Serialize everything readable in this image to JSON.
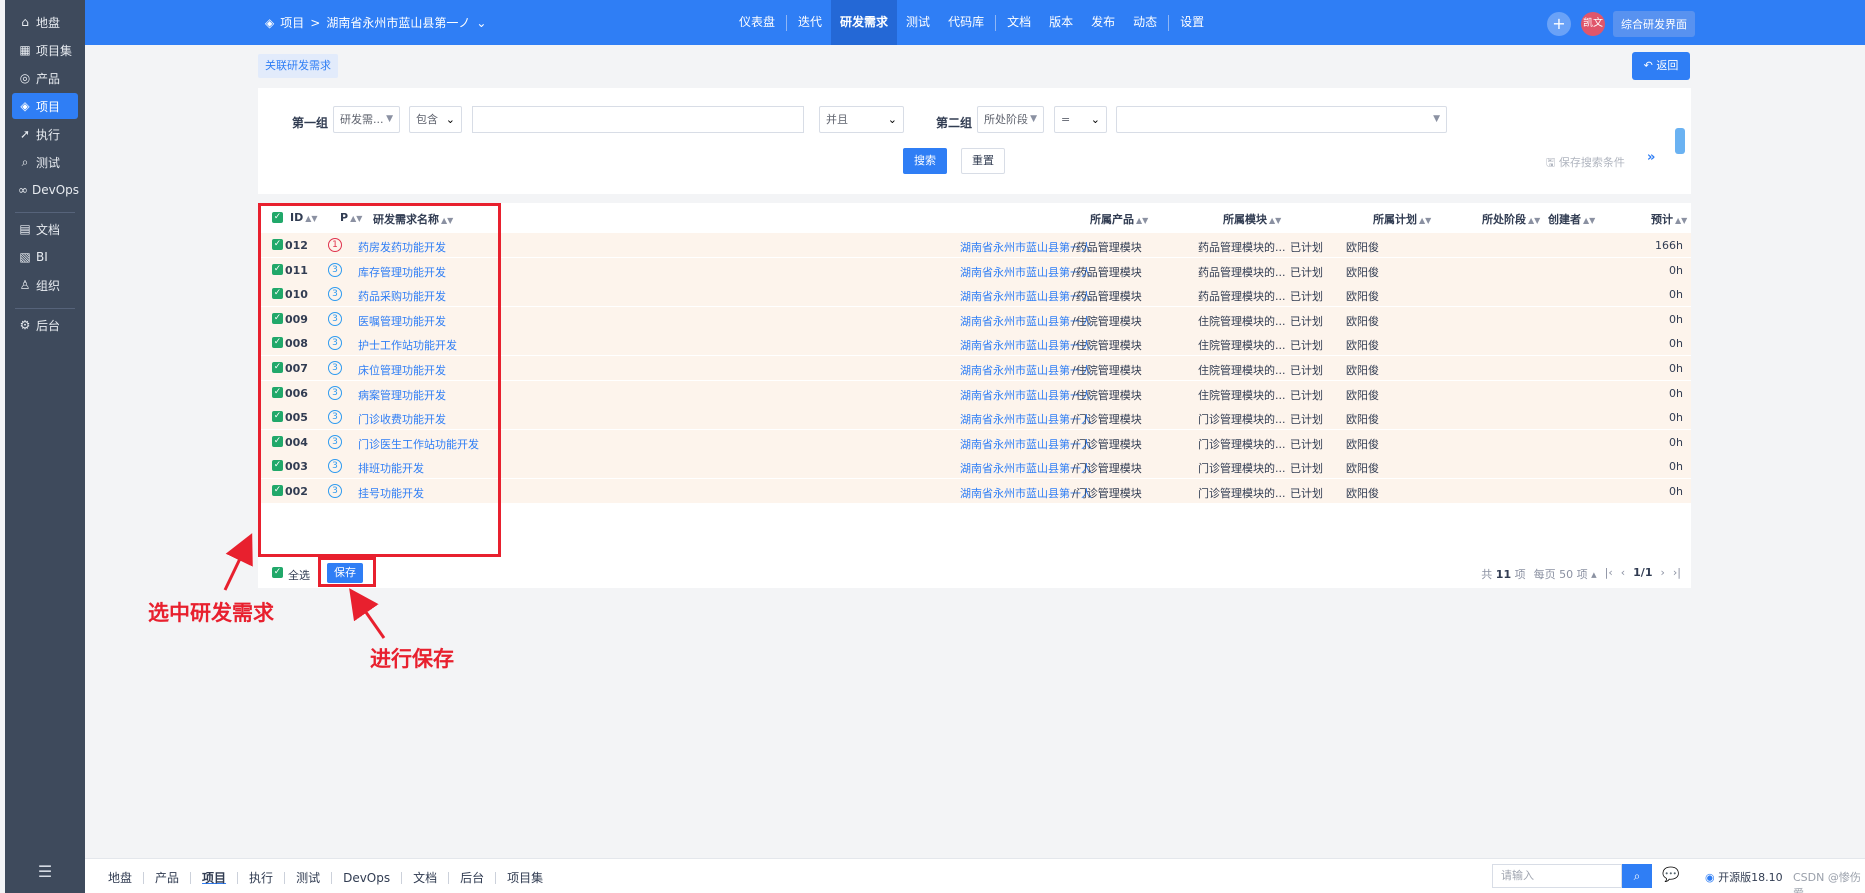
{
  "sidebar": {
    "items": [
      {
        "label": "地盘",
        "icon": "home-icon",
        "glyph": "⌂"
      },
      {
        "label": "项目集",
        "icon": "grid-icon",
        "glyph": "▦"
      },
      {
        "label": "产品",
        "icon": "bulb-icon",
        "glyph": "◎"
      },
      {
        "label": "项目",
        "icon": "project-icon",
        "glyph": "◈"
      },
      {
        "label": "执行",
        "icon": "run-icon",
        "glyph": "➚"
      },
      {
        "label": "测试",
        "icon": "search-icon",
        "glyph": "⌕"
      },
      {
        "label": "DevOps",
        "icon": "infinity-icon",
        "glyph": "∞"
      },
      {
        "label": "文档",
        "icon": "doc-icon",
        "glyph": "▤"
      },
      {
        "label": "BI",
        "icon": "chart-icon",
        "glyph": "▧"
      },
      {
        "label": "组织",
        "icon": "people-icon",
        "glyph": "♙"
      },
      {
        "label": "后台",
        "icon": "gear-icon",
        "glyph": "⚙"
      }
    ],
    "collapse_glyph": "☰"
  },
  "header": {
    "breadcrumb_root": "项目",
    "breadcrumb_sep": ">",
    "breadcrumb_project": "湖南省永州市蓝山县第一ノ",
    "nav": [
      "仪表盘",
      "迭代",
      "研发需求",
      "测试",
      "代码库",
      "文档",
      "版本",
      "发布",
      "动态",
      "设置"
    ],
    "active_nav": "研发需求",
    "avatar_text": "凯文",
    "right_button": "综合研发界面"
  },
  "toolbar": {
    "tag_label": "关联研发需求",
    "back_label": "返回"
  },
  "search": {
    "group1_label": "第一组",
    "group1_field": "研发需...",
    "group1_op": "包含",
    "group1_value": "",
    "logic": "并且",
    "group2_label": "第二组",
    "group2_field": "所处阶段",
    "group2_op": "=",
    "group2_value": "",
    "search_btn": "搜索",
    "reset_btn": "重置",
    "save_condition": "保存搜索条件"
  },
  "table": {
    "headers": {
      "id": "ID",
      "pri": "P",
      "name": "研发需求名称",
      "product": "所属产品",
      "module": "所属模块",
      "plan": "所属计划",
      "stage": "所处阶段",
      "creator": "创建者",
      "estimate": "预计"
    },
    "rows": [
      {
        "id": "012",
        "pri": "1",
        "name": "药房发药功能开发",
        "product": "湖南省永州市蓝山县第一人",
        "module": "/药品管理模块",
        "plan": "药品管理模块的...",
        "stage": "已计划",
        "creator": "欧阳俊",
        "estimate": "166h"
      },
      {
        "id": "011",
        "pri": "3",
        "name": "库存管理功能开发",
        "product": "湖南省永州市蓝山县第一人",
        "module": "/药品管理模块",
        "plan": "药品管理模块的...",
        "stage": "已计划",
        "creator": "欧阳俊",
        "estimate": "0h"
      },
      {
        "id": "010",
        "pri": "3",
        "name": "药品采购功能开发",
        "product": "湖南省永州市蓝山县第一人",
        "module": "/药品管理模块",
        "plan": "药品管理模块的...",
        "stage": "已计划",
        "creator": "欧阳俊",
        "estimate": "0h"
      },
      {
        "id": "009",
        "pri": "3",
        "name": "医嘱管理功能开发",
        "product": "湖南省永州市蓝山县第一人",
        "module": "/住院管理模块",
        "plan": "住院管理模块的...",
        "stage": "已计划",
        "creator": "欧阳俊",
        "estimate": "0h"
      },
      {
        "id": "008",
        "pri": "3",
        "name": "护士工作站功能开发",
        "product": "湖南省永州市蓝山县第一人",
        "module": "/住院管理模块",
        "plan": "住院管理模块的...",
        "stage": "已计划",
        "creator": "欧阳俊",
        "estimate": "0h"
      },
      {
        "id": "007",
        "pri": "3",
        "name": "床位管理功能开发",
        "product": "湖南省永州市蓝山县第一人",
        "module": "/住院管理模块",
        "plan": "住院管理模块的...",
        "stage": "已计划",
        "creator": "欧阳俊",
        "estimate": "0h"
      },
      {
        "id": "006",
        "pri": "3",
        "name": "病案管理功能开发",
        "product": "湖南省永州市蓝山县第一人",
        "module": "/住院管理模块",
        "plan": "住院管理模块的...",
        "stage": "已计划",
        "creator": "欧阳俊",
        "estimate": "0h"
      },
      {
        "id": "005",
        "pri": "3",
        "name": "门诊收费功能开发",
        "product": "湖南省永州市蓝山县第一人",
        "module": "/门诊管理模块",
        "plan": "门诊管理模块的...",
        "stage": "已计划",
        "creator": "欧阳俊",
        "estimate": "0h"
      },
      {
        "id": "004",
        "pri": "3",
        "name": "门诊医生工作站功能开发",
        "product": "湖南省永州市蓝山县第一人",
        "module": "/门诊管理模块",
        "plan": "门诊管理模块的...",
        "stage": "已计划",
        "creator": "欧阳俊",
        "estimate": "0h"
      },
      {
        "id": "003",
        "pri": "3",
        "name": "排班功能开发",
        "product": "湖南省永州市蓝山县第一人",
        "module": "/门诊管理模块",
        "plan": "门诊管理模块的...",
        "stage": "已计划",
        "creator": "欧阳俊",
        "estimate": "0h"
      },
      {
        "id": "002",
        "pri": "3",
        "name": "挂号功能开发",
        "product": "湖南省永州市蓝山县第一人",
        "module": "/门诊管理模块",
        "plan": "门诊管理模块的...",
        "stage": "已计划",
        "creator": "欧阳俊",
        "estimate": "0h"
      }
    ],
    "select_all": "全选",
    "save_btn": "保存",
    "pager_total_prefix": "共",
    "pager_total": "11",
    "pager_total_suffix": "项",
    "pager_per_page": "每页 50 项",
    "pager_page": "1/1"
  },
  "annotations": {
    "select_text": "选中研发需求",
    "save_text": "进行保存"
  },
  "bottombar": {
    "items": [
      "地盘",
      "产品",
      "项目",
      "执行",
      "测试",
      "DevOps",
      "文档",
      "后台",
      "项目集"
    ],
    "active": "项目",
    "search_placeholder": "请输入",
    "open_source": "开源版18.10",
    "watermark": "CSDN @惨伤爱"
  },
  "colors": {
    "primary": "#2f7ef5",
    "sidebar": "#3e4a5c",
    "annotation": "#e8202e",
    "row_highlight": "#fdf4ec",
    "check": "#21a86a"
  }
}
